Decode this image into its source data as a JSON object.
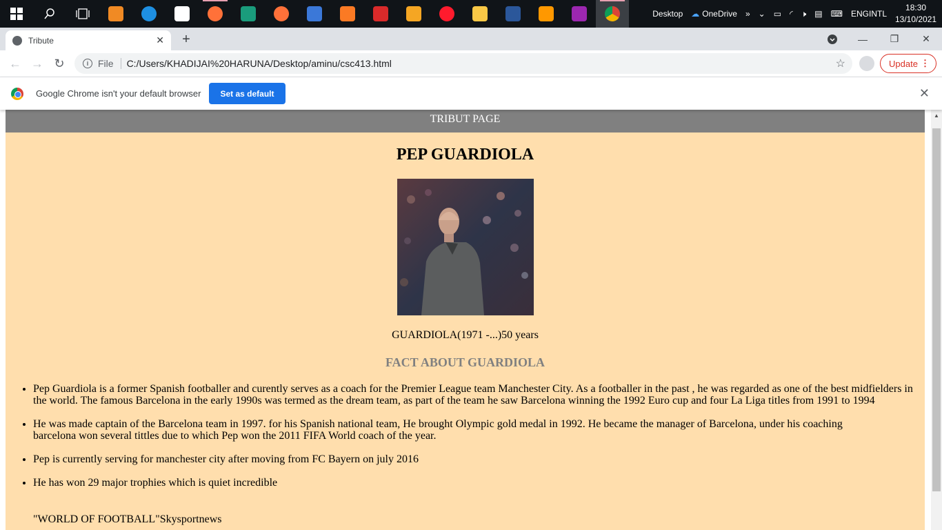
{
  "taskbar": {
    "apps": [
      {
        "icon": "windows-start-icon",
        "color": "#ffffff"
      },
      {
        "icon": "search-icon",
        "color": "#ffffff"
      },
      {
        "icon": "task-view-icon",
        "color": "#ffffff"
      },
      {
        "icon": "media-player-icon",
        "color": "#f08a24"
      },
      {
        "icon": "edge-icon",
        "color": "#1e8fe1"
      },
      {
        "icon": "store-icon",
        "color": "#ffffff"
      },
      {
        "icon": "firefox-icon",
        "color": "#ff7139"
      },
      {
        "icon": "publisher-icon",
        "color": "#1a9c7c"
      },
      {
        "icon": "firefox-alt-icon",
        "color": "#ff7139"
      },
      {
        "icon": "network-app-icon",
        "color": "#3b78d8"
      },
      {
        "icon": "xampp-icon",
        "color": "#fb7a24"
      },
      {
        "icon": "app-red-icon",
        "color": "#d92a2a"
      },
      {
        "icon": "uc-browser-icon",
        "color": "#f5a623"
      },
      {
        "icon": "opera-icon",
        "color": "#ff1b2d"
      },
      {
        "icon": "file-explorer-icon",
        "color": "#f9c846"
      },
      {
        "icon": "word-icon",
        "color": "#2b579a"
      },
      {
        "icon": "sublime-icon",
        "color": "#ff9800"
      },
      {
        "icon": "winrar-icon",
        "color": "#9c27b0"
      },
      {
        "icon": "chrome-icon",
        "color": "#4285f4"
      }
    ],
    "tray": {
      "desktop_label": "Desktop",
      "onedrive_label": "OneDrive",
      "lang_line1": "ENG",
      "lang_line2": "INTL",
      "time": "18:30",
      "date": "13/10/2021"
    }
  },
  "browser": {
    "tab_title": "Tribute",
    "scheme_label": "File",
    "url": "C:/Users/KHADIJAI%20HARUNA/Desktop/aminu/csc413.html",
    "update_label": "Update",
    "infobar_text": "Google Chrome isn't your default browser",
    "set_default_label": "Set as default"
  },
  "page": {
    "banner": "TRIBUT PAGE",
    "heading": "PEP GUARDIOLA",
    "caption": "GUARDIOLA(1971 -...)50 years",
    "facts_title": "FACT ABOUT GUARDIOLA",
    "facts": [
      "Pep Guardiola is a former Spanish footballer and curently serves as a coach for the Premier League team Manchester City. As a footballer in the past , he was regarded as one of the best midfielders in the world. The famous Barcelona in the early 1990s was termed as the dream team, as part of the team he saw Barcelona winning the 1992 Euro cup and four La Liga titles from 1991 to 1994",
      "He was made captain of the Barcelona team in 1997. for his Spanish national team, He brought Olympic gold medal in 1992. He became the manager of Barcelona, under his coaching barcelona won several tittles due to which Pep won the 2011 FIFA World coach of the year.",
      "Pep is currently serving for manchester city after moving from FC Bayern on july 2016",
      "He has won 29 major trophies which is quiet incredible"
    ],
    "source": "\"WORLD OF FOOTBALL\"Skysportnews"
  }
}
